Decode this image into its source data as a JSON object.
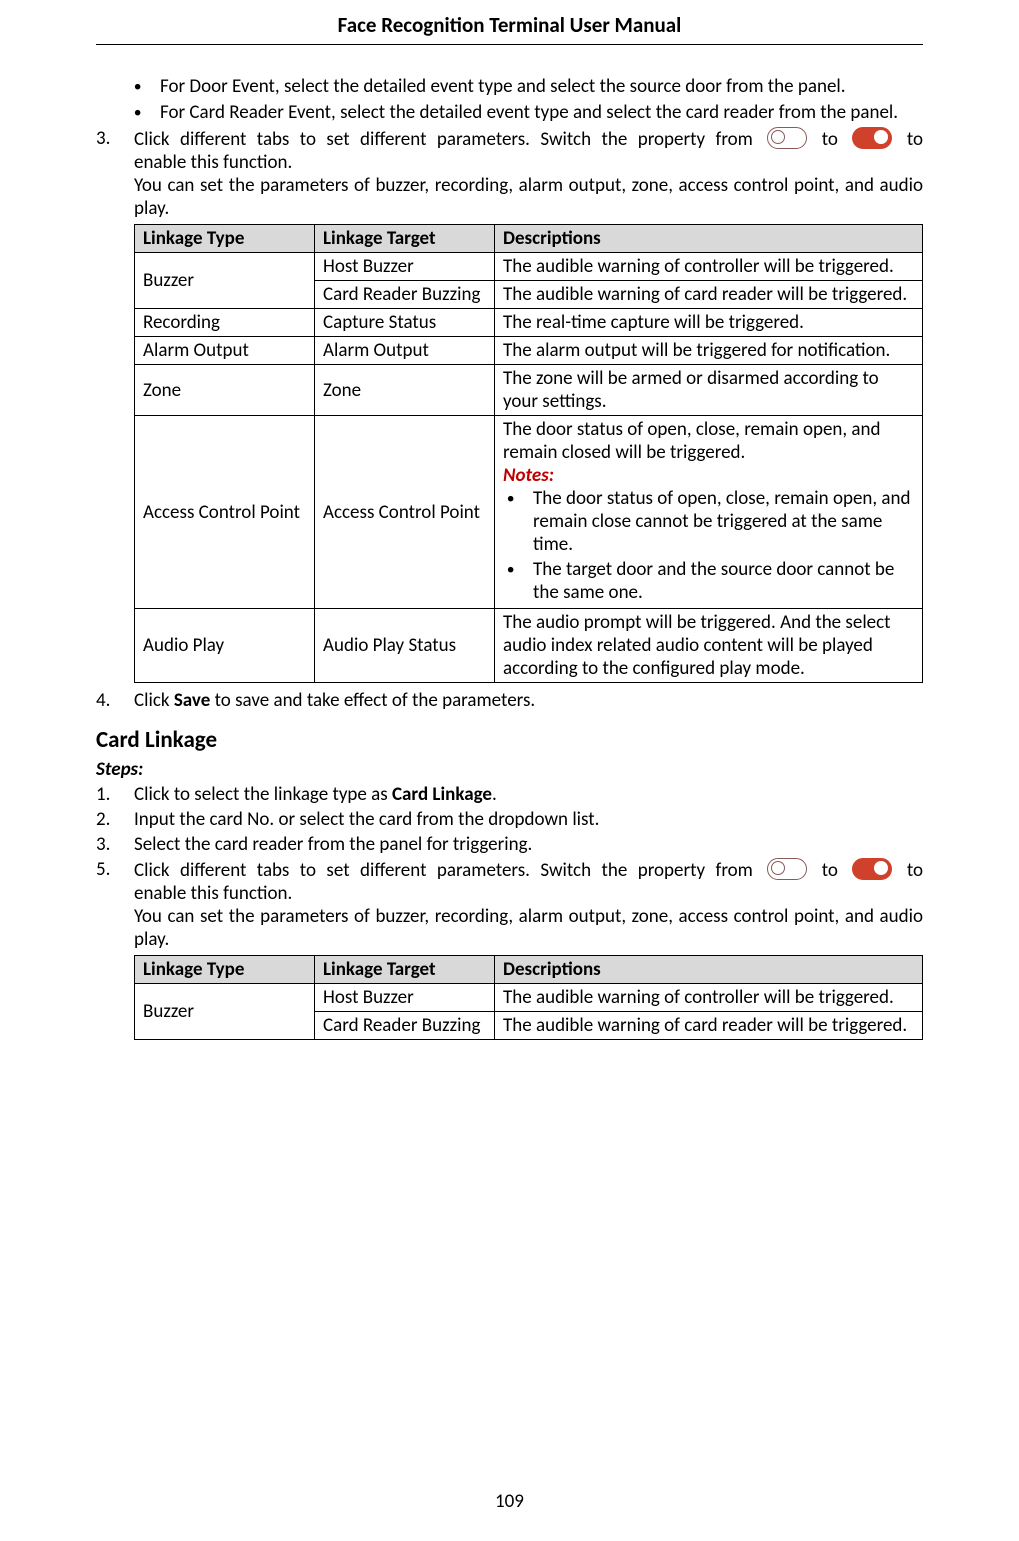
{
  "doc_title": "Face Recognition Terminal  User Manual",
  "page_number": "109",
  "top_bullets": [
    "For Door Event, select the detailed event type and select the source door from the panel.",
    "For Card Reader Event, select the detailed event type and select the card reader from the panel."
  ],
  "list_a": {
    "item3_num": "3.",
    "item3_pre": "Click  different  tabs  to  set  different  parameters.  Switch  the  property  from ",
    "item3_mid": " to ",
    "item3_post": " to",
    "item3_line2": "enable this function.",
    "item3_line3": "You can set the parameters of buzzer, recording, alarm output, zone, access control point, and audio play.",
    "item4_num": "4.",
    "item4_pre": "Click ",
    "item4_bold": "Save",
    "item4_post": " to save and take effect of the parameters."
  },
  "table1": {
    "headers": [
      "Linkage Type",
      "Linkage Target",
      "Descriptions"
    ],
    "buzzer_label": "Buzzer",
    "buzzer_row1_target": "Host Buzzer",
    "buzzer_row1_desc": "The audible warning of controller will be triggered.",
    "buzzer_row2_target": "Card Reader Buzzing",
    "buzzer_row2_desc": "The audible warning of card reader will be triggered.",
    "recording_label": "Recording",
    "recording_target": "Capture Status",
    "recording_desc": "The real-time capture will be triggered.",
    "alarm_label": "Alarm Output",
    "alarm_target": "Alarm Output",
    "alarm_desc": "The alarm output will be triggered for notification.",
    "zone_label": "Zone",
    "zone_target": "Zone",
    "zone_desc": "The zone will be armed or disarmed according to your settings.",
    "acp_label": "Access Control Point",
    "acp_target": "Access Control Point",
    "acp_desc_line": "The door status of open, close, remain open, and remain closed will be triggered.",
    "acp_notes_label": "Notes:",
    "acp_note1": "The door status of open, close, remain open, and remain close cannot be triggered at the same time.",
    "acp_note2": "The target door and the source door cannot be the same one.",
    "audio_label": "Audio Play",
    "audio_target": "Audio Play Status",
    "audio_desc": "The audio prompt will be triggered. And the select audio index related audio content will be played according to the configured play mode."
  },
  "card_linkage": {
    "heading": "Card Linkage",
    "steps_label": "Steps:",
    "step1_num": "1.",
    "step1_pre": "Click to select the linkage type as ",
    "step1_bold": "Card Linkage",
    "step1_post": ".",
    "step2_num": "2.",
    "step2_text": "Input the card No. or select the card from the dropdown list.",
    "step3_num": "3.",
    "step3_text": "Select the card reader from the panel for triggering.",
    "step5_num": "5.",
    "step5_pre": "Click  different  tabs  to  set  different  parameters.  Switch  the  property  from ",
    "step5_mid": " to ",
    "step5_post": " to",
    "step5_line2": "enable this function.",
    "step5_line3": "You can set the parameters of buzzer, recording, alarm output, zone, access control point, and audio play."
  },
  "table2": {
    "headers": [
      "Linkage Type",
      "Linkage Target",
      "Descriptions"
    ],
    "buzzer_label": "Buzzer",
    "buzzer_row1_target": "Host Buzzer",
    "buzzer_row1_desc": "The audible warning of controller will be triggered.",
    "buzzer_row2_target": "Card Reader Buzzing",
    "buzzer_row2_desc": "The audible warning of card reader will be triggered."
  }
}
